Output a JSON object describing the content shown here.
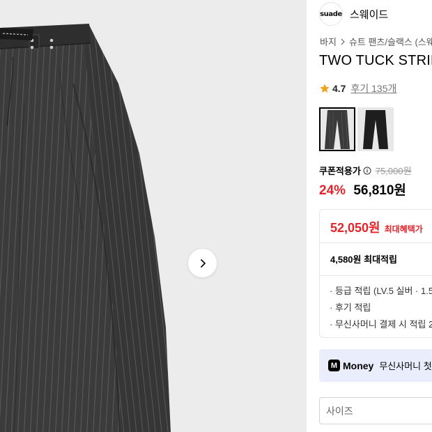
{
  "gallery": {
    "next_icon": "chevron-right-icon"
  },
  "brand": {
    "logo_text": "suade",
    "name": "스웨이드"
  },
  "breadcrumb": {
    "items": [
      "바지",
      "슈트 팬츠/슬랙스 (스웨"
    ],
    "separator_icon": "chevron-right-icon"
  },
  "product": {
    "title": "TWO TUCK STRIPE"
  },
  "rating": {
    "icon": "star-icon",
    "score": "4.7",
    "reviews_label": "후기 135개",
    "star_color": "#f4a11d"
  },
  "pricing": {
    "coupon_label": "쿠폰적용가",
    "info_icon": "info-circle-icon",
    "original_price": "75,000원",
    "discount": "24%",
    "sale_price": "56,810원",
    "accent_color": "#e3242b"
  },
  "benefits": {
    "max_price": "52,050원",
    "max_label": "최대혜택가",
    "points_total": "4,580원 최대적립",
    "points_items": [
      "· 등급 적립 (LV.5 실버 · 1.5",
      "· 후기 적립",
      "· 무신사머니 결제 시 적립 2"
    ]
  },
  "money_banner": {
    "icon_letter": "M",
    "brand": "Money",
    "text": "무신사머니 첫",
    "background": "#eaeefc"
  },
  "size_select": {
    "placeholder": "사이즈"
  }
}
